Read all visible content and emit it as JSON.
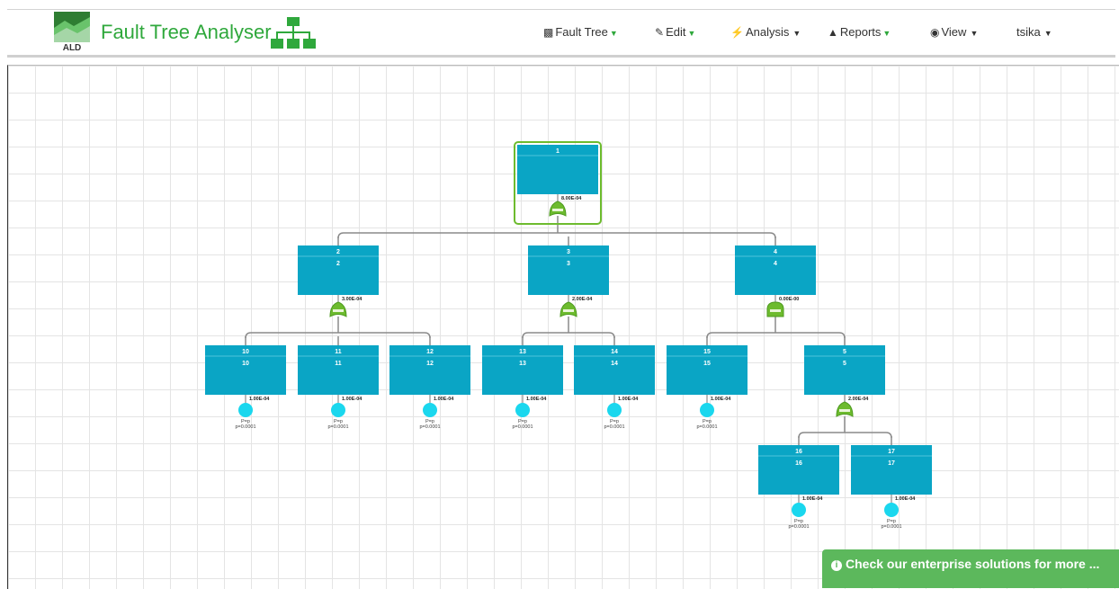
{
  "app": {
    "title": "Fault Tree Analyser",
    "logo_text": "ALD"
  },
  "menu": {
    "fault_tree": {
      "label": "Fault Tree",
      "icon": "sitemap-icon"
    },
    "edit": {
      "label": "Edit",
      "icon": "edit-icon"
    },
    "analysis": {
      "label": "Analysis",
      "icon": "bolt-icon"
    },
    "reports": {
      "label": "Reports",
      "icon": "road-icon"
    },
    "view": {
      "label": "View",
      "icon": "eye-icon"
    },
    "user": {
      "label": "tsika"
    }
  },
  "tree": {
    "events": [
      {
        "id": "1",
        "desc": "",
        "prob": "8.00E-04",
        "gate": "OR"
      },
      {
        "id": "2",
        "desc": "2",
        "prob": "3.00E-04",
        "gate": "OR"
      },
      {
        "id": "3",
        "desc": "3",
        "prob": "2.00E-04",
        "gate": "OR"
      },
      {
        "id": "4",
        "desc": "4",
        "prob": "0.00E-00",
        "gate": "AND"
      },
      {
        "id": "10",
        "desc": "10",
        "prob": "1.00E-04"
      },
      {
        "id": "11",
        "desc": "11",
        "prob": "1.00E-04"
      },
      {
        "id": "12",
        "desc": "12",
        "prob": "1.00E-04"
      },
      {
        "id": "13",
        "desc": "13",
        "prob": "1.00E-04"
      },
      {
        "id": "14",
        "desc": "14",
        "prob": "1.00E-04"
      },
      {
        "id": "15",
        "desc": "15",
        "prob": "1.00E-04"
      },
      {
        "id": "5",
        "desc": "5",
        "prob": "2.00E-04",
        "gate": "OR"
      },
      {
        "id": "16",
        "desc": "16",
        "prob": "1.00E-04"
      },
      {
        "id": "17",
        "desc": "17",
        "prob": "1.00E-04"
      }
    ],
    "basic_label": "P=p",
    "basic_value": "p=0.0001"
  },
  "promo": {
    "text": "Check our enterprise solutions for more ..."
  },
  "colors": {
    "brand_green": "#2fa83c",
    "event_box": "#0aa5c5",
    "gate_green": "#6dbb2e",
    "basic_circle": "#1ad7ee",
    "promo_green": "#5cb85c"
  }
}
